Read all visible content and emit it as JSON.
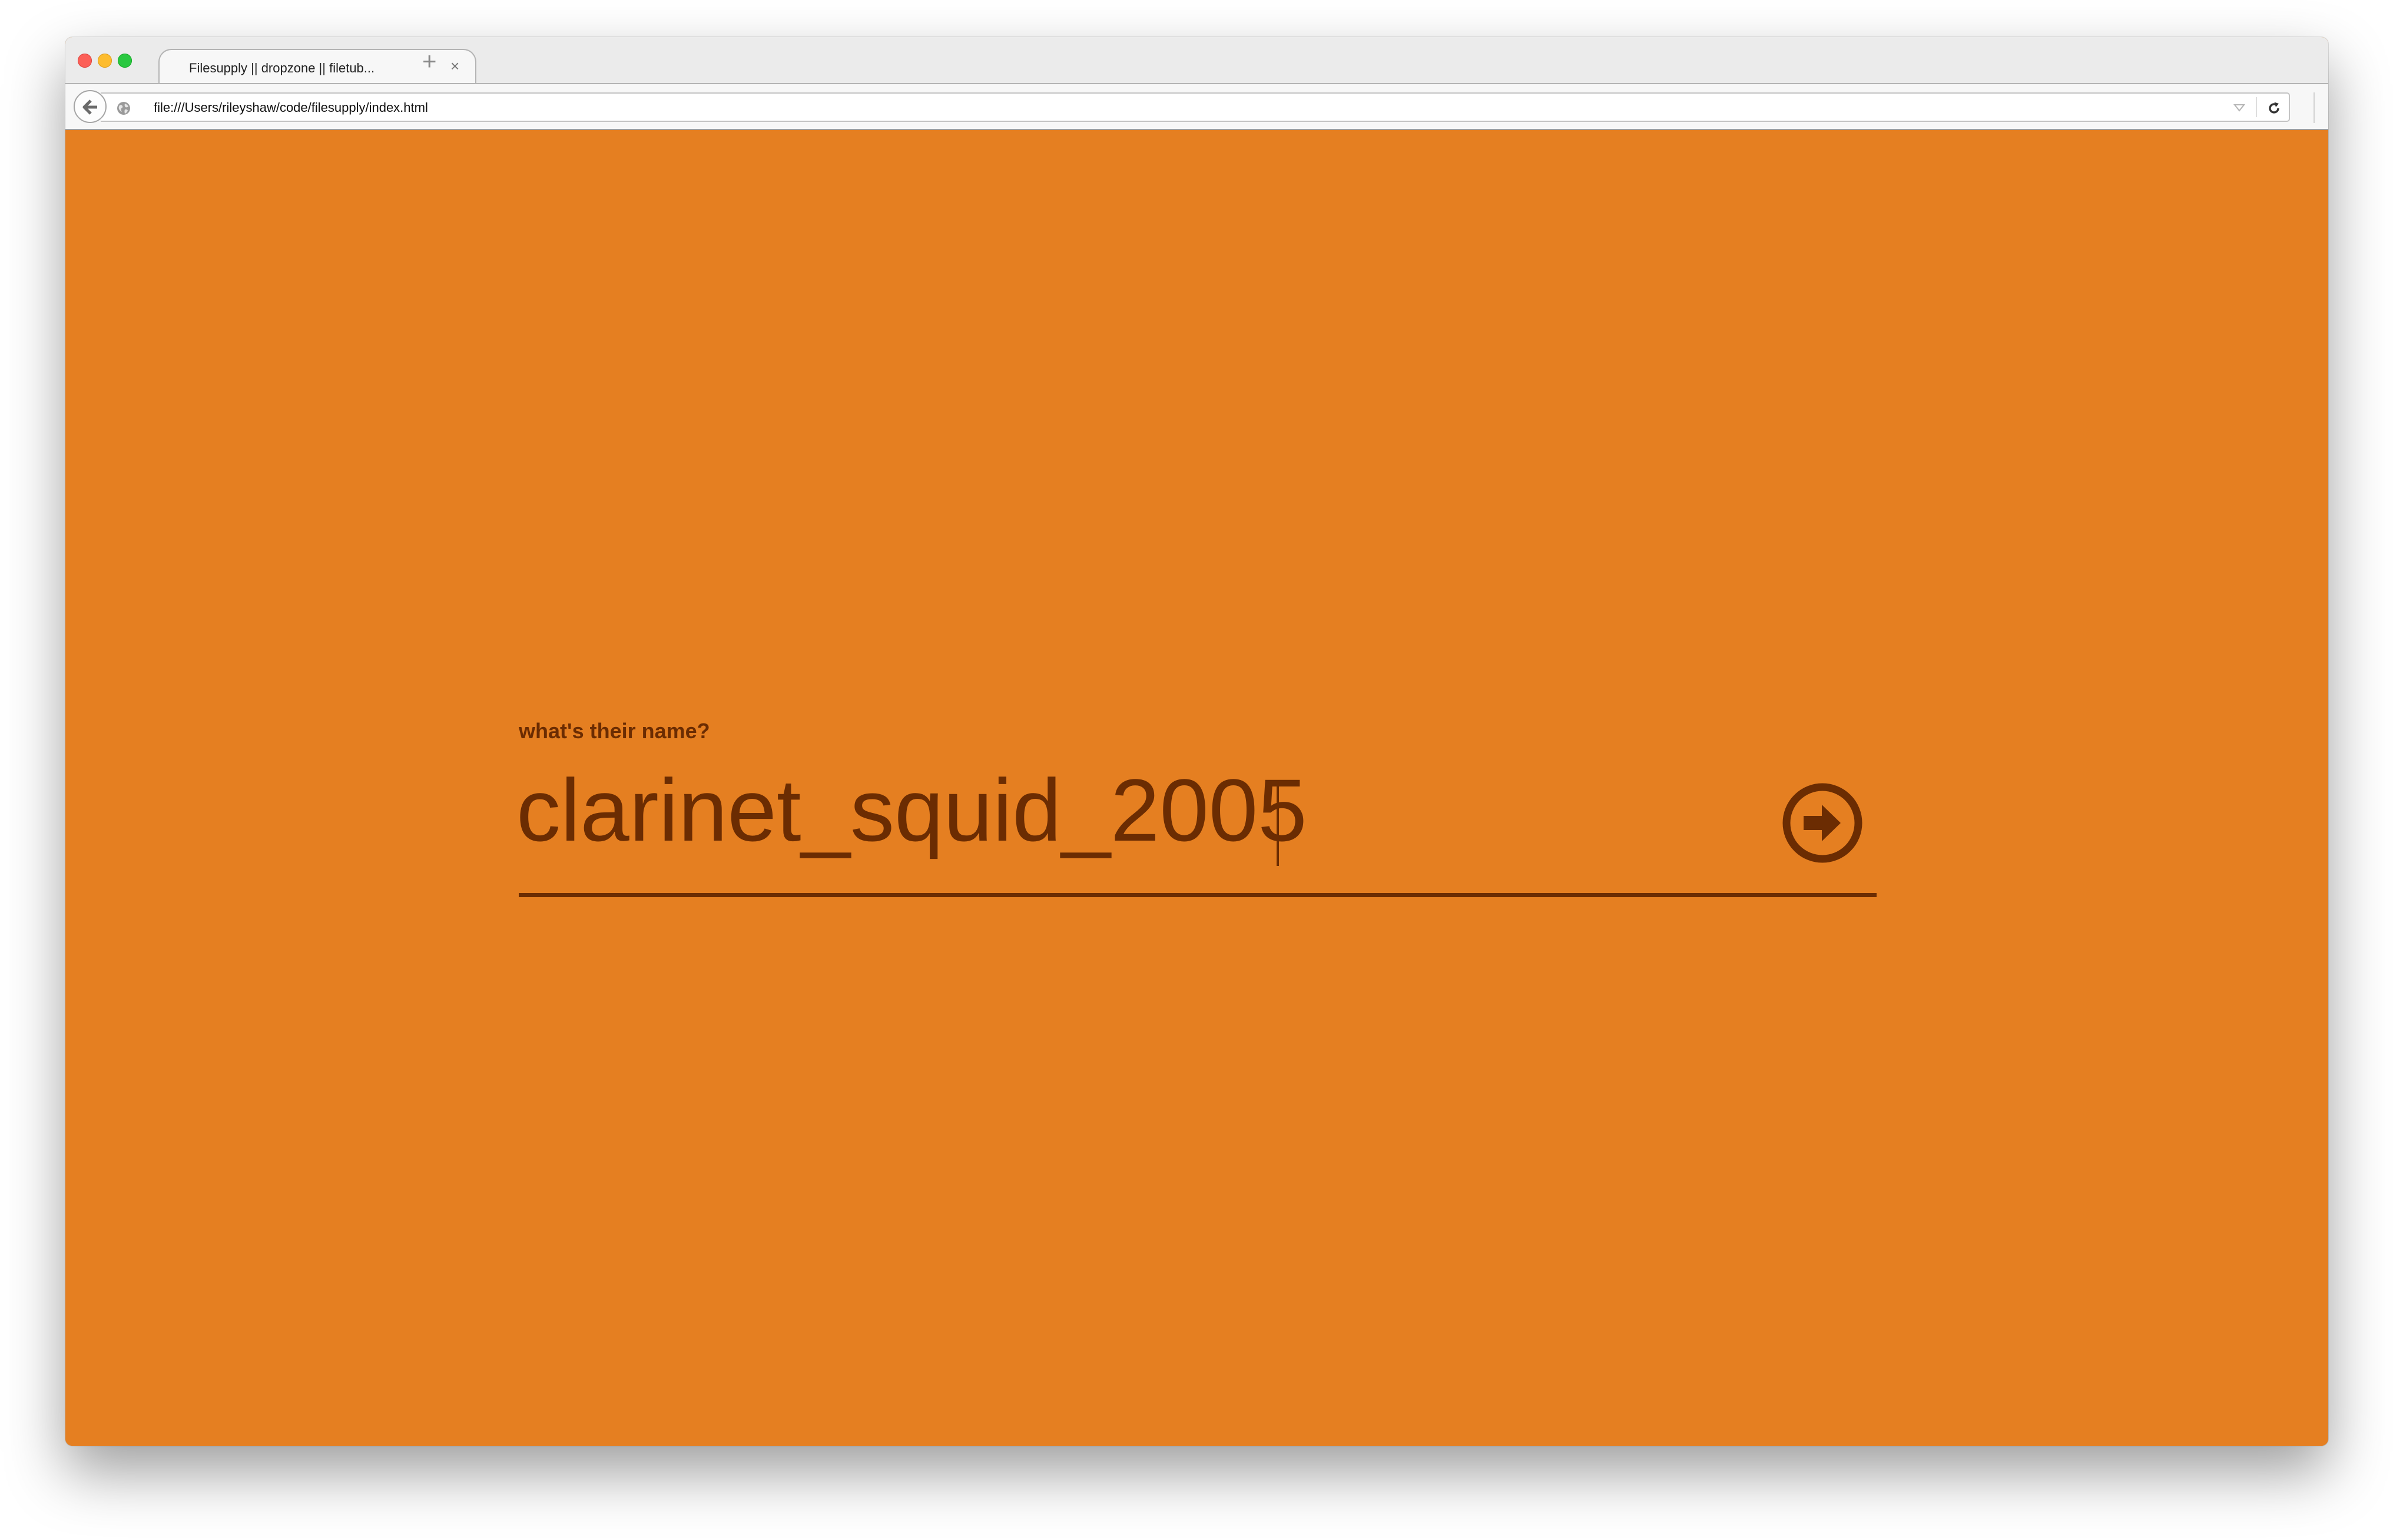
{
  "browser": {
    "tab": {
      "title": "Filesupply || dropzone || filetub...",
      "close_glyph": "×"
    },
    "new_tab_glyph": "+",
    "url": "file:///Users/rileyshaw/code/filesupply/index.html",
    "icons": {
      "back": "back-arrow-icon",
      "site": "globe-icon",
      "dropdown": "dropdown-marker-icon",
      "reload": "reload-icon",
      "menu": "hamburger-menu-icon"
    }
  },
  "page": {
    "background_color": "#E57F21",
    "accent_color": "#6b2c02",
    "prompt": "what's their name?",
    "name_value": "clarinet_squid_2005",
    "submit_icon": "arrow-right-circle-icon"
  }
}
